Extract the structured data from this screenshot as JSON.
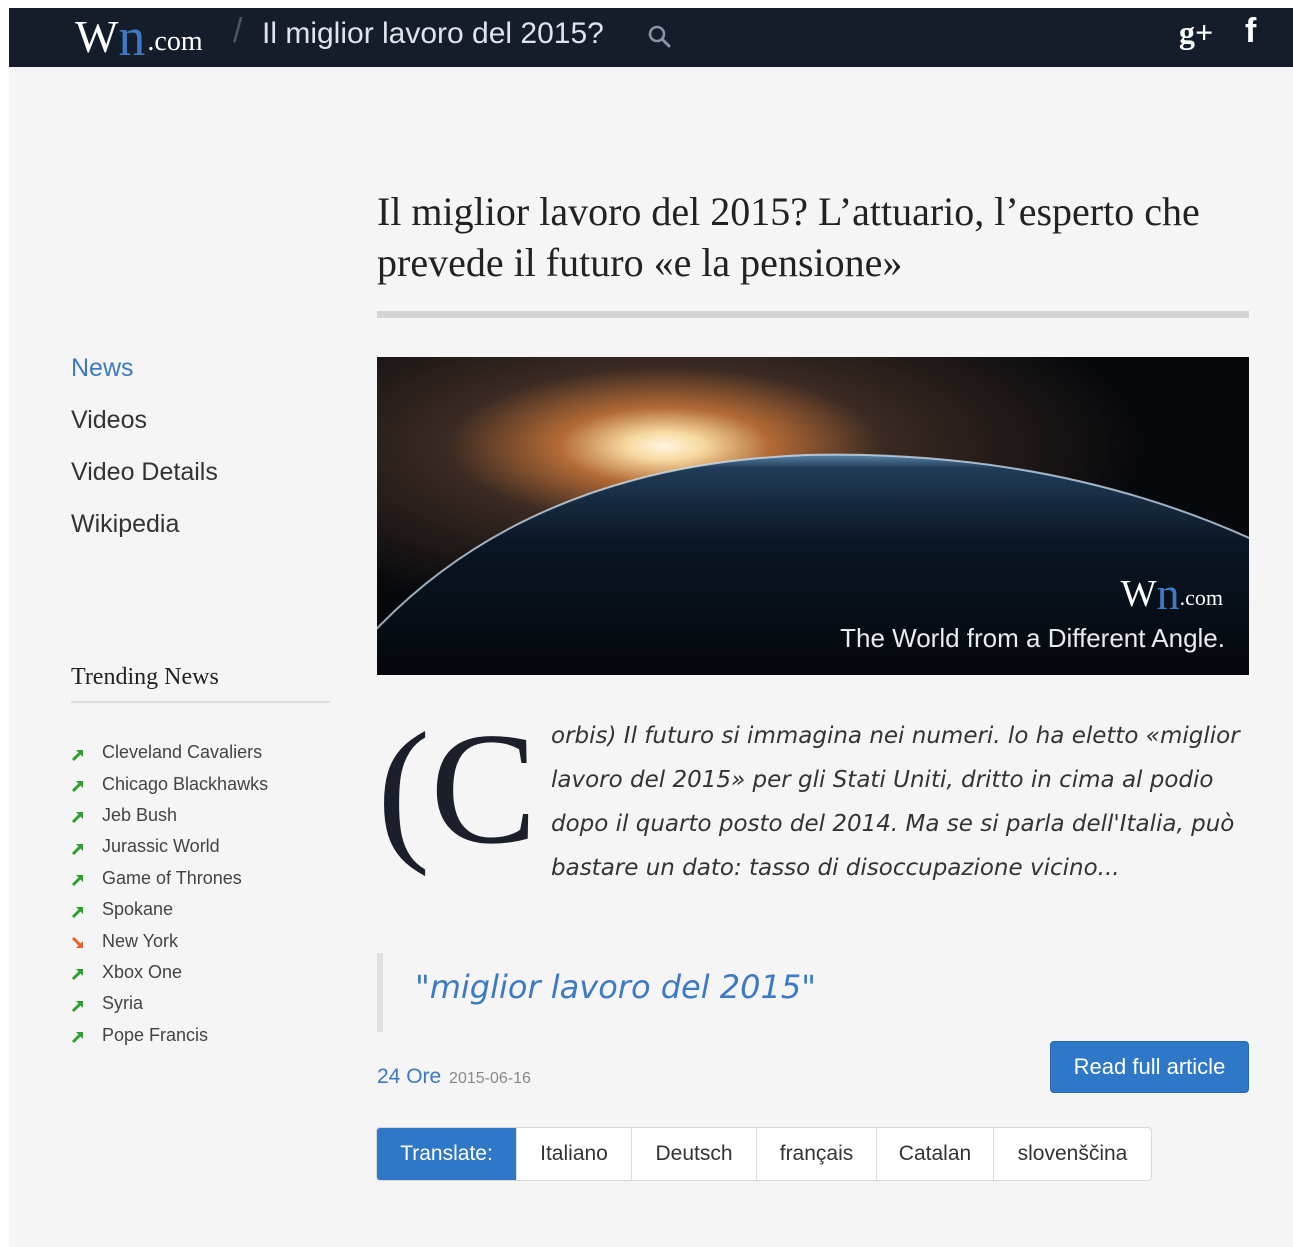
{
  "header": {
    "logo": {
      "w": "W",
      "n": "n",
      "domain": ".com"
    },
    "separator": "/",
    "title": "Il miglior lavoro del 2015?",
    "icons": {
      "search": "search-icon",
      "gplus": "google-plus-icon",
      "facebook": "facebook-icon"
    },
    "gplus_glyph": "g+",
    "fb_glyph": "f"
  },
  "sidebar": {
    "nav": [
      {
        "label": "News",
        "active": true
      },
      {
        "label": "Videos",
        "active": false
      },
      {
        "label": "Video Details",
        "active": false
      },
      {
        "label": "Wikipedia",
        "active": false
      }
    ],
    "trending_title": "Trending News",
    "trending": [
      {
        "label": "Cleveland Cavaliers",
        "trend": "up"
      },
      {
        "label": "Chicago Blackhawks",
        "trend": "up"
      },
      {
        "label": "Jeb Bush",
        "trend": "up"
      },
      {
        "label": "Jurassic World",
        "trend": "up"
      },
      {
        "label": "Game of Thrones",
        "trend": "up"
      },
      {
        "label": "Spokane",
        "trend": "up"
      },
      {
        "label": "New York",
        "trend": "down"
      },
      {
        "label": "Xbox One",
        "trend": "up"
      },
      {
        "label": "Syria",
        "trend": "up"
      },
      {
        "label": "Pope Francis",
        "trend": "up"
      }
    ]
  },
  "article": {
    "headline": "Il miglior lavoro del 2015? L’attuario, l’esperto che prevede il futuro «e la pensione»",
    "hero": {
      "logo": {
        "w": "W",
        "n": "n",
        "domain": ".com"
      },
      "tagline": "The World from a Different Angle."
    },
    "dropcap": "(C",
    "lede": "orbis) Il futuro si immagina nei numeri. lo ha eletto «miglior lavoro del 2015» per gli Stati Uniti, dritto in cima al podio dopo il quarto posto del 2014. Ma se si parla dell'Italia, può bastare un dato: tasso di disoccupazione vicino...",
    "quote": "\"miglior lavoro del 2015\"",
    "source": "24 Ore",
    "date": "2015-06-16",
    "read_button": "Read full article"
  },
  "translate": {
    "label": "Translate:",
    "languages": [
      "Italiano",
      "Deutsch",
      "français",
      "Catalan",
      "slovenščina"
    ]
  },
  "colors": {
    "topbar": "#151d2b",
    "accent": "#3d79c4",
    "button": "#2f78c7",
    "trend_up": "#2e9e2e",
    "trend_down": "#e8632b"
  }
}
